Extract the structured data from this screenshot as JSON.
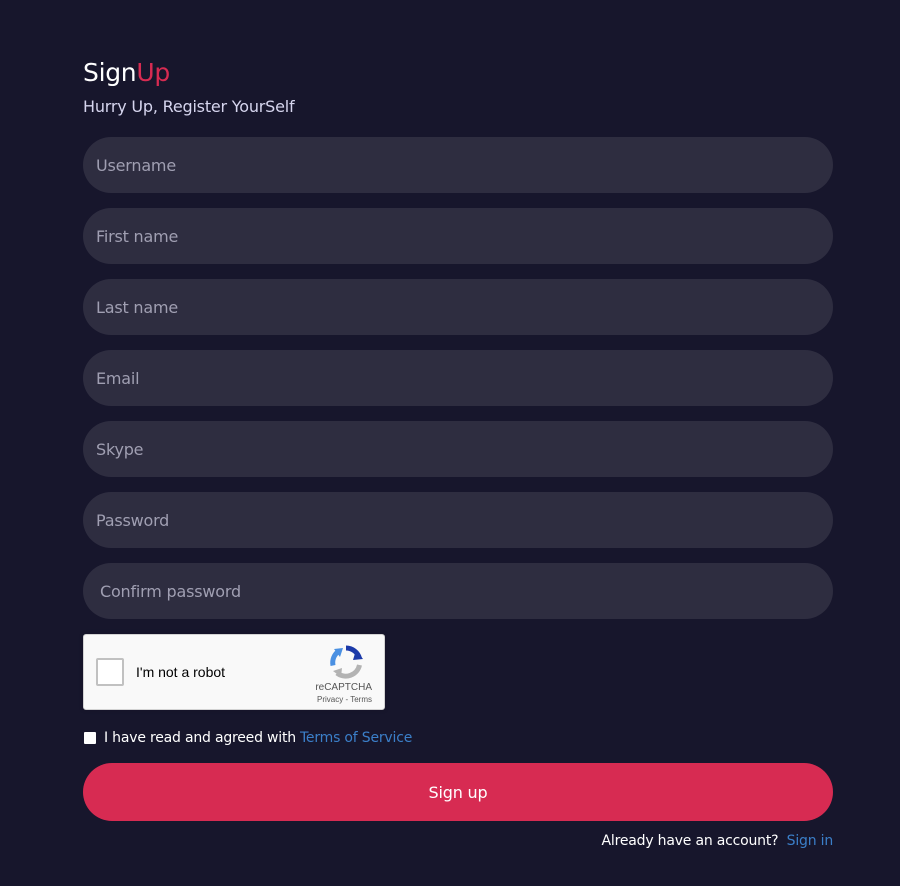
{
  "header": {
    "title_main": "Sign",
    "title_accent": "Up",
    "subtitle": "Hurry Up, Register YourSelf"
  },
  "form": {
    "fields": {
      "username": {
        "placeholder": "Username",
        "value": ""
      },
      "first_name": {
        "placeholder": "First name",
        "value": ""
      },
      "last_name": {
        "placeholder": "Last name",
        "value": ""
      },
      "email": {
        "placeholder": "Email",
        "value": ""
      },
      "skype": {
        "placeholder": "Skype",
        "value": ""
      },
      "password": {
        "placeholder": "Password",
        "value": ""
      },
      "confirm_password": {
        "placeholder": "Confirm password",
        "value": ""
      }
    },
    "recaptcha": {
      "label": "I'm not a robot",
      "brand": "reCAPTCHA",
      "privacy": "Privacy",
      "separator": "-",
      "terms": "Terms",
      "checked": false
    },
    "agreement": {
      "text": "I have read and agreed with",
      "link": "Terms of Service",
      "checked": false
    },
    "submit_label": "Sign up"
  },
  "footer": {
    "prompt": "Already have an account?",
    "link": "Sign in"
  },
  "colors": {
    "background": "#17162c",
    "field_background": "#2e2d40",
    "accent": "#d72b52",
    "link": "#3b7fc9"
  }
}
